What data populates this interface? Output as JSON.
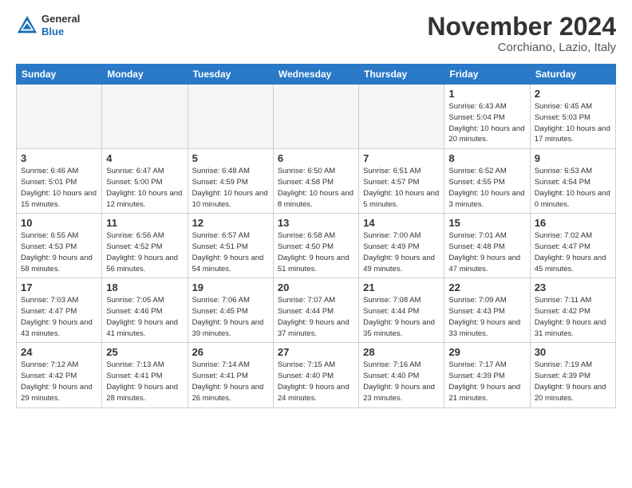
{
  "header": {
    "logo_general": "General",
    "logo_blue": "Blue",
    "month_title": "November 2024",
    "location": "Corchiano, Lazio, Italy"
  },
  "days_of_week": [
    "Sunday",
    "Monday",
    "Tuesday",
    "Wednesday",
    "Thursday",
    "Friday",
    "Saturday"
  ],
  "weeks": [
    [
      {
        "day": "",
        "info": ""
      },
      {
        "day": "",
        "info": ""
      },
      {
        "day": "",
        "info": ""
      },
      {
        "day": "",
        "info": ""
      },
      {
        "day": "",
        "info": ""
      },
      {
        "day": "1",
        "info": "Sunrise: 6:43 AM\nSunset: 5:04 PM\nDaylight: 10 hours and 20 minutes."
      },
      {
        "day": "2",
        "info": "Sunrise: 6:45 AM\nSunset: 5:03 PM\nDaylight: 10 hours and 17 minutes."
      }
    ],
    [
      {
        "day": "3",
        "info": "Sunrise: 6:46 AM\nSunset: 5:01 PM\nDaylight: 10 hours and 15 minutes."
      },
      {
        "day": "4",
        "info": "Sunrise: 6:47 AM\nSunset: 5:00 PM\nDaylight: 10 hours and 12 minutes."
      },
      {
        "day": "5",
        "info": "Sunrise: 6:48 AM\nSunset: 4:59 PM\nDaylight: 10 hours and 10 minutes."
      },
      {
        "day": "6",
        "info": "Sunrise: 6:50 AM\nSunset: 4:58 PM\nDaylight: 10 hours and 8 minutes."
      },
      {
        "day": "7",
        "info": "Sunrise: 6:51 AM\nSunset: 4:57 PM\nDaylight: 10 hours and 5 minutes."
      },
      {
        "day": "8",
        "info": "Sunrise: 6:52 AM\nSunset: 4:55 PM\nDaylight: 10 hours and 3 minutes."
      },
      {
        "day": "9",
        "info": "Sunrise: 6:53 AM\nSunset: 4:54 PM\nDaylight: 10 hours and 0 minutes."
      }
    ],
    [
      {
        "day": "10",
        "info": "Sunrise: 6:55 AM\nSunset: 4:53 PM\nDaylight: 9 hours and 58 minutes."
      },
      {
        "day": "11",
        "info": "Sunrise: 6:56 AM\nSunset: 4:52 PM\nDaylight: 9 hours and 56 minutes."
      },
      {
        "day": "12",
        "info": "Sunrise: 6:57 AM\nSunset: 4:51 PM\nDaylight: 9 hours and 54 minutes."
      },
      {
        "day": "13",
        "info": "Sunrise: 6:58 AM\nSunset: 4:50 PM\nDaylight: 9 hours and 51 minutes."
      },
      {
        "day": "14",
        "info": "Sunrise: 7:00 AM\nSunset: 4:49 PM\nDaylight: 9 hours and 49 minutes."
      },
      {
        "day": "15",
        "info": "Sunrise: 7:01 AM\nSunset: 4:48 PM\nDaylight: 9 hours and 47 minutes."
      },
      {
        "day": "16",
        "info": "Sunrise: 7:02 AM\nSunset: 4:47 PM\nDaylight: 9 hours and 45 minutes."
      }
    ],
    [
      {
        "day": "17",
        "info": "Sunrise: 7:03 AM\nSunset: 4:47 PM\nDaylight: 9 hours and 43 minutes."
      },
      {
        "day": "18",
        "info": "Sunrise: 7:05 AM\nSunset: 4:46 PM\nDaylight: 9 hours and 41 minutes."
      },
      {
        "day": "19",
        "info": "Sunrise: 7:06 AM\nSunset: 4:45 PM\nDaylight: 9 hours and 39 minutes."
      },
      {
        "day": "20",
        "info": "Sunrise: 7:07 AM\nSunset: 4:44 PM\nDaylight: 9 hours and 37 minutes."
      },
      {
        "day": "21",
        "info": "Sunrise: 7:08 AM\nSunset: 4:44 PM\nDaylight: 9 hours and 35 minutes."
      },
      {
        "day": "22",
        "info": "Sunrise: 7:09 AM\nSunset: 4:43 PM\nDaylight: 9 hours and 33 minutes."
      },
      {
        "day": "23",
        "info": "Sunrise: 7:11 AM\nSunset: 4:42 PM\nDaylight: 9 hours and 31 minutes."
      }
    ],
    [
      {
        "day": "24",
        "info": "Sunrise: 7:12 AM\nSunset: 4:42 PM\nDaylight: 9 hours and 29 minutes."
      },
      {
        "day": "25",
        "info": "Sunrise: 7:13 AM\nSunset: 4:41 PM\nDaylight: 9 hours and 28 minutes."
      },
      {
        "day": "26",
        "info": "Sunrise: 7:14 AM\nSunset: 4:41 PM\nDaylight: 9 hours and 26 minutes."
      },
      {
        "day": "27",
        "info": "Sunrise: 7:15 AM\nSunset: 4:40 PM\nDaylight: 9 hours and 24 minutes."
      },
      {
        "day": "28",
        "info": "Sunrise: 7:16 AM\nSunset: 4:40 PM\nDaylight: 9 hours and 23 minutes."
      },
      {
        "day": "29",
        "info": "Sunrise: 7:17 AM\nSunset: 4:39 PM\nDaylight: 9 hours and 21 minutes."
      },
      {
        "day": "30",
        "info": "Sunrise: 7:19 AM\nSunset: 4:39 PM\nDaylight: 9 hours and 20 minutes."
      }
    ]
  ]
}
